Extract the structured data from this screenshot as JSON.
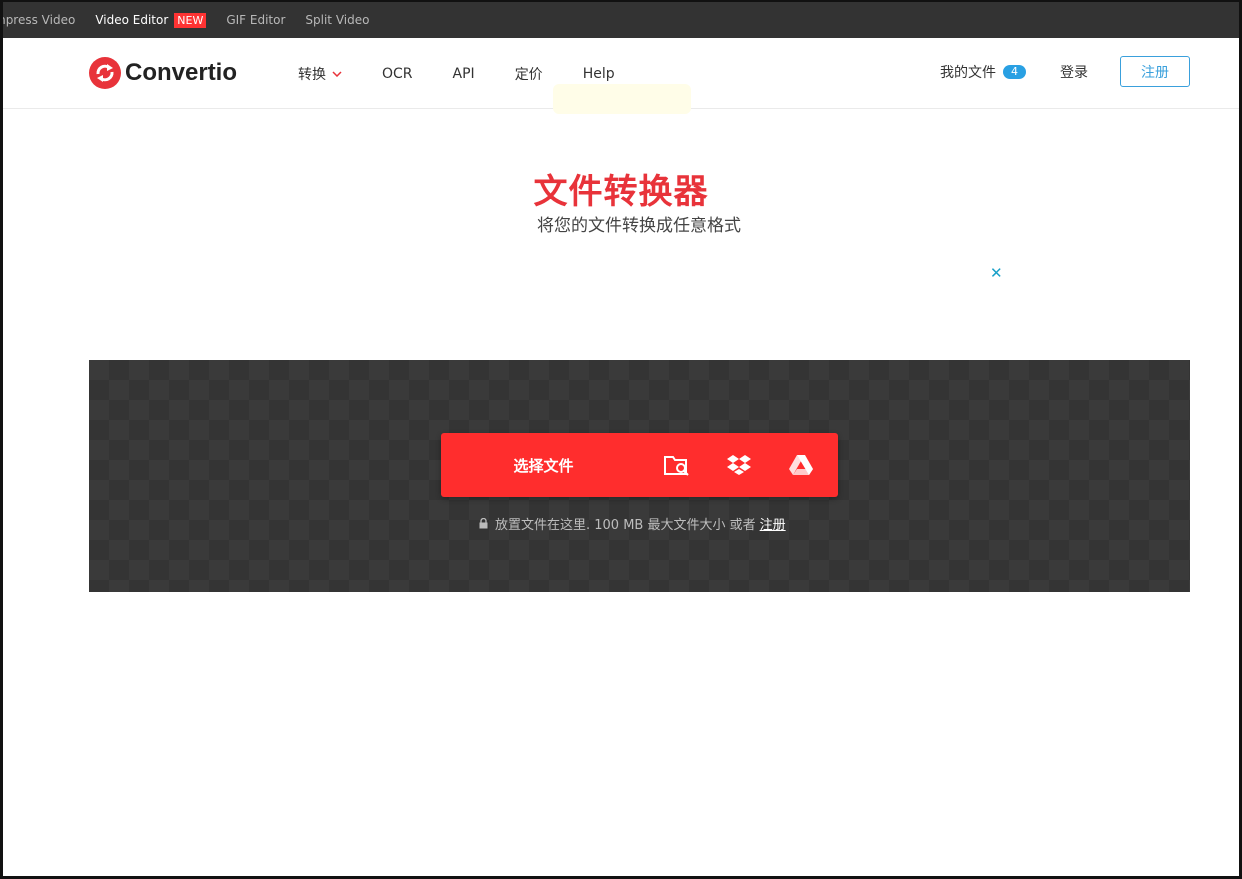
{
  "topbar": {
    "links": [
      {
        "label": "mpress Video"
      },
      {
        "label": "Video Editor",
        "badge": "NEW"
      },
      {
        "label": "GIF Editor"
      },
      {
        "label": "Split Video"
      }
    ]
  },
  "header": {
    "logo_text": "Convertio",
    "nav": {
      "convert": "转换",
      "ocr": "OCR",
      "api": "API",
      "pricing": "定价",
      "help": "Help"
    },
    "my_files": "我的文件",
    "my_files_count": "4",
    "login": "登录",
    "register": "注册"
  },
  "hero": {
    "title": "文件转换器",
    "subtitle": "将您的文件转换成任意格式"
  },
  "ad": {
    "close": "✕"
  },
  "upload": {
    "choose_files": "选择文件",
    "hint_text": "放置文件在这里. 100 MB 最大文件大小 或者",
    "hint_link": "注册"
  },
  "colors": {
    "brand_red": "#e8333a",
    "button_red": "#ff2d2d",
    "link_blue": "#3aa0dc",
    "topbar_bg": "#333333"
  }
}
